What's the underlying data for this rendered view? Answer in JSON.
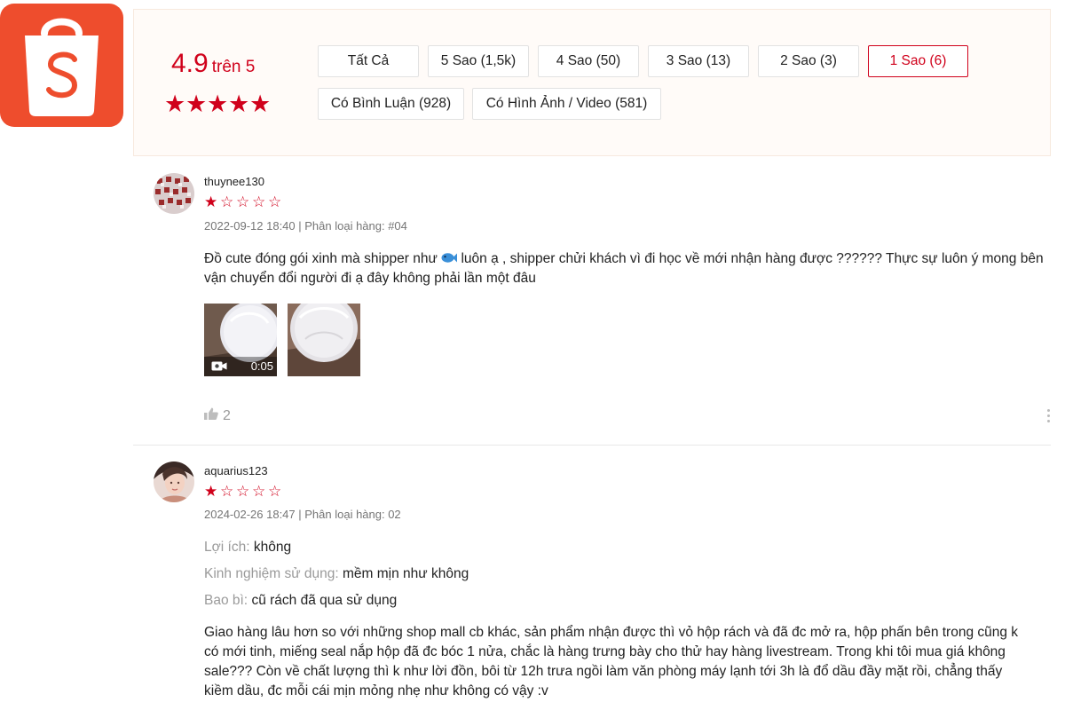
{
  "brand": {
    "logo_icon": "shopee-bag-icon",
    "color": "#ee4d2d"
  },
  "rating_summary": {
    "score": "4.9",
    "out_of": "trên 5",
    "stars": 5,
    "accent": "#d0011b"
  },
  "filters": [
    {
      "label": "Tất Cả",
      "active": false
    },
    {
      "label": "5 Sao (1,5k)",
      "active": false
    },
    {
      "label": "4 Sao (50)",
      "active": false
    },
    {
      "label": "3 Sao (13)",
      "active": false
    },
    {
      "label": "2 Sao (3)",
      "active": false
    },
    {
      "label": "1 Sao (6)",
      "active": true
    },
    {
      "label": "Có Bình Luận (928)",
      "active": false
    },
    {
      "label": "Có Hình Ảnh / Video (581)",
      "active": false
    }
  ],
  "reviews": [
    {
      "username": "thuynee130",
      "stars": 1,
      "meta": "2022-09-12 18:40 | Phân loại hàng: #04",
      "text_1": "Đồ cute đóng gói xinh mà shipper như",
      "emoji": "fish-emoji",
      "text_2": "luôn ạ , shipper chửi khách vì đi học về mới nhận hàng được ?????? Thực sự luôn ý mong bên vận chuyển đổi người đi ạ đây không phải lần một đâu",
      "media": [
        {
          "type": "video",
          "icon": "video-camera-icon",
          "duration": "0:05"
        },
        {
          "type": "image"
        }
      ],
      "likes": "2",
      "like_icon": "thumbs-up-icon",
      "more_icon": "more-vertical-icon"
    },
    {
      "username": "aquarius123",
      "stars": 1,
      "meta": "2024-02-26 18:47 | Phân loại hàng: 02",
      "attributes": [
        {
          "label": "Lợi ích:",
          "value": "không"
        },
        {
          "label": "Kinh nghiệm sử dụng:",
          "value": "mềm mịn như không"
        },
        {
          "label": "Bao bì:",
          "value": "cũ rách đã qua sử dụng"
        }
      ],
      "text_lines": [
        "Giao hàng lâu hơn so với những shop mall cb khác, sản phẩm nhận được thì vỏ hộp rách và đã đc mở ra, hộp phấn bên trong cũng k",
        "có mới tinh, miếng seal nắp hộp đã đc bóc 1 nửa, chắc là hàng trưng bày cho thử hay hàng livestream. Trong khi tôi mua giá không",
        "sale??? Còn về chất lượng thì k như lời đồn, bôi từ 12h trưa ngồi làm văn phòng máy lạnh tới 3h là đổ dầu đầy mặt rồi, chẳng thấy",
        "kiềm dầu, đc mỗi cái mịn mỏng nhẹ như không có vậy :v"
      ]
    }
  ]
}
